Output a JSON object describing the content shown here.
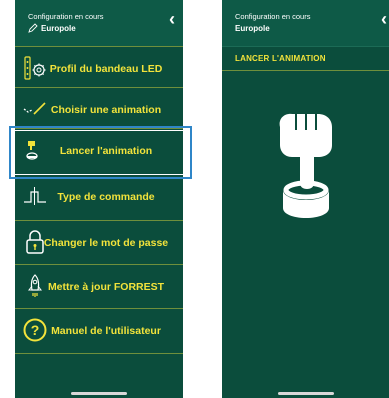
{
  "left": {
    "header": {
      "config_label": "Configuration en cours",
      "config_name": "Europole"
    },
    "menu": [
      {
        "label": "Profil du bandeau LED",
        "icon": "led-strip-gear-icon"
      },
      {
        "label": "Choisir une animation",
        "icon": "animation-wave-icon"
      },
      {
        "label": "Lancer l'animation",
        "icon": "press-button-icon"
      },
      {
        "label": "Type de commande",
        "icon": "command-signal-icon"
      },
      {
        "label": "Changer le mot de passe",
        "icon": "padlock-icon"
      },
      {
        "label": "Mettre à jour FORREST",
        "icon": "rocket-icon"
      },
      {
        "label": "Manuel de l'utilisateur",
        "icon": "help-circle-icon"
      }
    ],
    "selected_index": 2
  },
  "right": {
    "header": {
      "config_label": "Configuration en cours",
      "config_name": "Europole"
    },
    "title": "LANCER L'ANIMATION"
  },
  "colors": {
    "background": "#0b4d3c",
    "accent": "#f2e33b",
    "selection": "#2f86c8"
  }
}
